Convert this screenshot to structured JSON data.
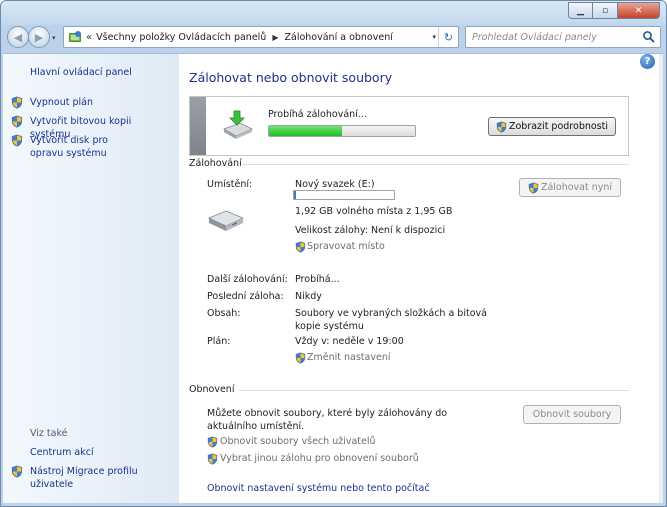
{
  "window": {
    "caption": {
      "minimize": "▁",
      "maximize": "▫",
      "close": "✕"
    }
  },
  "nav": {
    "back": "◀",
    "forward": "▶",
    "dropdown": "▾",
    "refresh": "↻"
  },
  "address": {
    "chevrons": "«",
    "crumbs": [
      "Všechny položky Ovládacích panelů",
      "Zálohování a obnovení"
    ],
    "separator": "▶",
    "dropdown": "▾"
  },
  "search": {
    "placeholder": "Prohledat Ovládací panely"
  },
  "sidebar": {
    "home": "Hlavní ovládací panel",
    "tasks": [
      {
        "label": "Vypnout plán"
      },
      {
        "label": "Vytvořit bitovou kopii systému"
      },
      {
        "label": "Vytvořit disk pro opravu systému"
      }
    ],
    "see_also_label": "Viz také",
    "see_also": [
      {
        "label": "Centrum akcí"
      },
      {
        "label": "Nástroj Migrace profilu uživatele"
      }
    ]
  },
  "main": {
    "title": "Zálohovat nebo obnovit soubory",
    "progress": {
      "label": "Probíhá zálohování...",
      "value": 0.5,
      "details_button": "Zobrazit podrobnosti"
    },
    "backup": {
      "heading": "Zálohování",
      "location_label": "Umístění:",
      "location_value": "Nový svazek (E:)",
      "space_used_fraction": 0.02,
      "free_space": "1,92 GB volného místa z 1,95 GB",
      "backup_size": "Velikost zálohy: Není k dispozici",
      "manage_space": "Spravovat místo",
      "backup_now": "Zálohovat nyní",
      "next_label": "Další zálohování:",
      "next_value": "Probíhá...",
      "last_label": "Poslední záloha:",
      "last_value": "Nikdy",
      "contents_label": "Obsah:",
      "contents_value": "Soubory ve vybraných složkách a bitová kopie systému",
      "schedule_label": "Plán:",
      "schedule_value": "Vždy v: neděle v 19:00",
      "change_settings": "Změnit nastavení"
    },
    "restore": {
      "heading": "Obnovení",
      "description": "Můžete obnovit soubory, které byly zálohovány do aktuálního umístění.",
      "restore_files": "Obnovit soubory",
      "restore_all_users": "Obnovit soubory všech uživatelů",
      "select_other_backup": "Vybrat jinou zálohu pro obnovení souborů",
      "recover_system": "Obnovit nastavení systému nebo tento počítač"
    }
  },
  "help": "?"
}
